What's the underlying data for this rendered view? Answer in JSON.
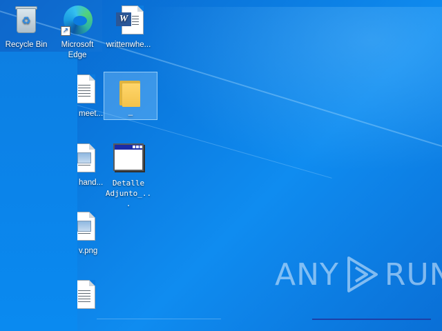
{
  "desktop": {
    "icons": [
      {
        "label": "Recycle Bin"
      },
      {
        "label": "Microsoft Edge"
      },
      {
        "label": "writtenwhe..."
      },
      {
        "label": "meet..."
      },
      {
        "label": "_"
      },
      {
        "label": "hand..."
      },
      {
        "label": "Detalle Adjunto_..."
      },
      {
        "label": "v.png"
      }
    ]
  },
  "watermark": {
    "left_text": "ANY",
    "right_text": "RUN"
  },
  "colors": {
    "desktop_blue": "#0b7be0",
    "selection": "#96d2ff",
    "folder_yellow": "#f4c24a",
    "word_blue": "#2b5797"
  }
}
